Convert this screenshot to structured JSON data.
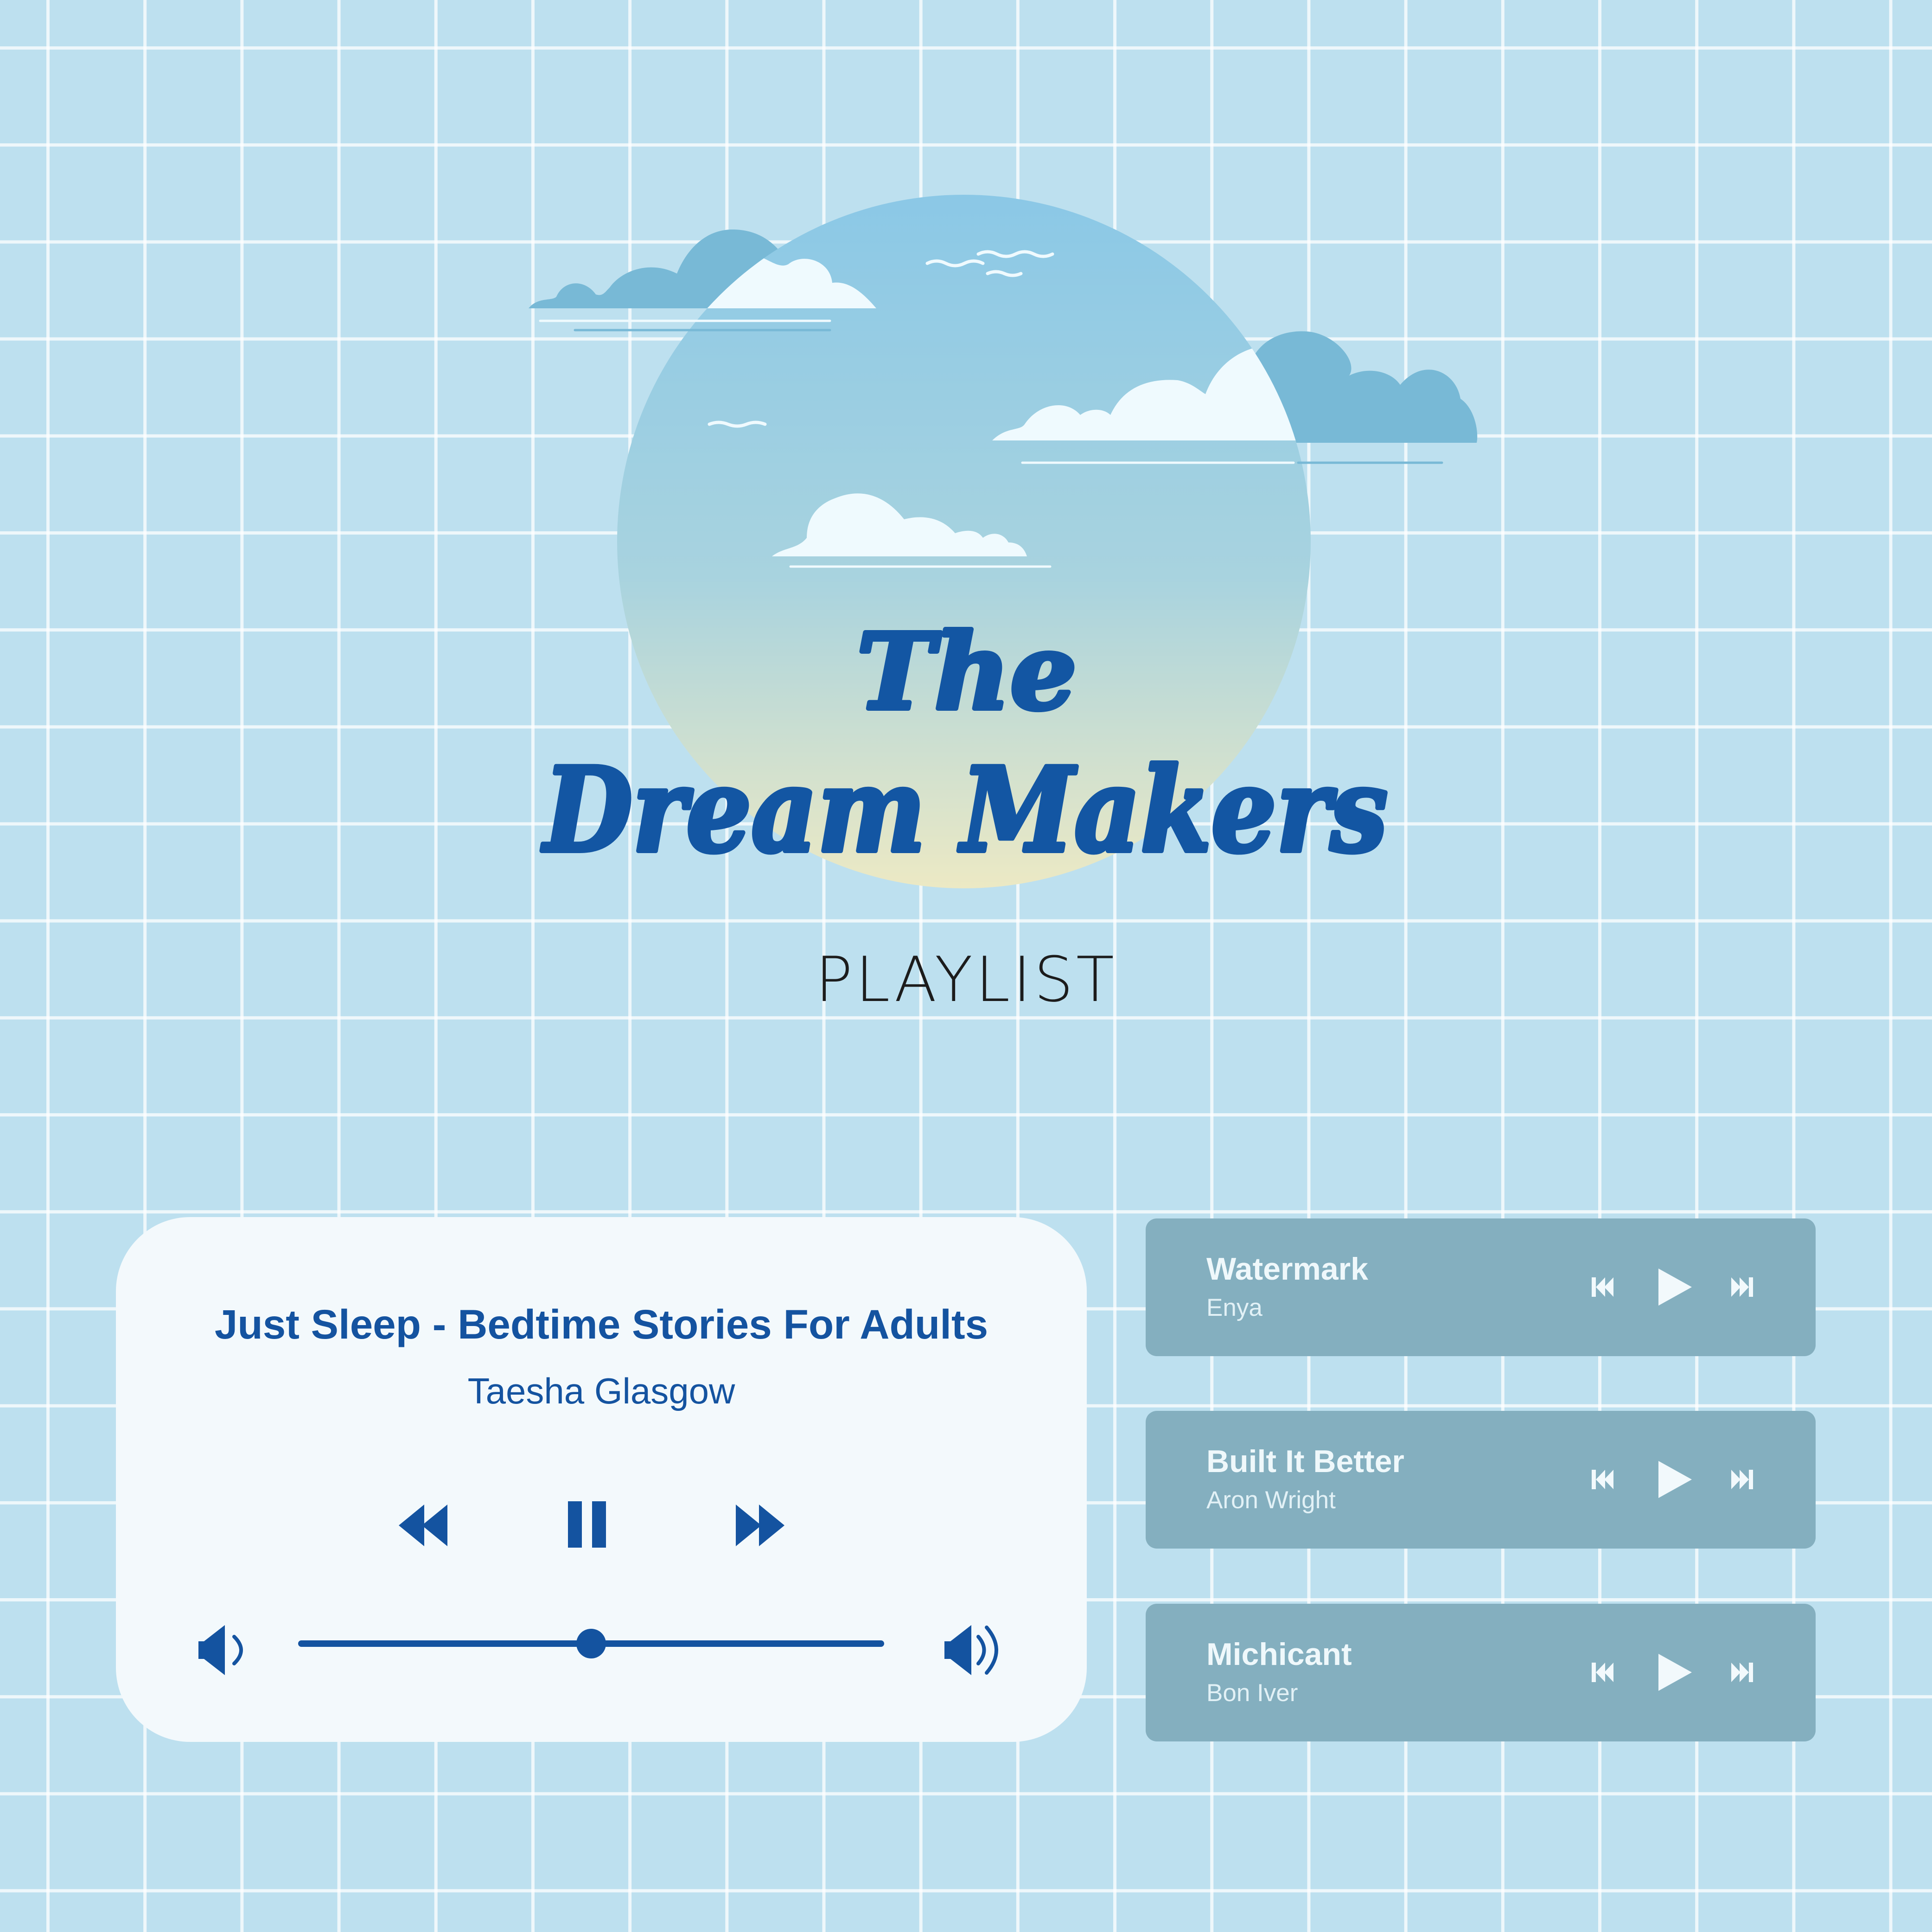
{
  "logo": {
    "line1": "The",
    "line2": "Dream Makers"
  },
  "playlist_label": "PLAYLIST",
  "now_playing": {
    "title": "Just Sleep - Bedtime Stories For Adults",
    "artist": "Taesha Glasgow",
    "controls": [
      "rewind-icon",
      "pause-icon",
      "fast-forward-icon"
    ],
    "volume_icons": [
      "volume-low-icon",
      "volume-high-icon"
    ],
    "volume_level": 0.5
  },
  "queue": [
    {
      "title": "Watermark",
      "artist": "Enya"
    },
    {
      "title": "Built It Better",
      "artist": "Aron Wright"
    },
    {
      "title": "Michicant",
      "artist": "Bon Iver"
    }
  ],
  "queue_controls": [
    "skip-back-icon",
    "play-icon",
    "skip-forward-icon"
  ],
  "colors": {
    "background": "#bde0ef",
    "grid": "#ffffff",
    "accent_blue": "#1356a3",
    "card": "#f3f9fc",
    "queue_card": "#84afbf",
    "cloud_dark": "#78b9d6",
    "cloud_light": "#effafe"
  }
}
